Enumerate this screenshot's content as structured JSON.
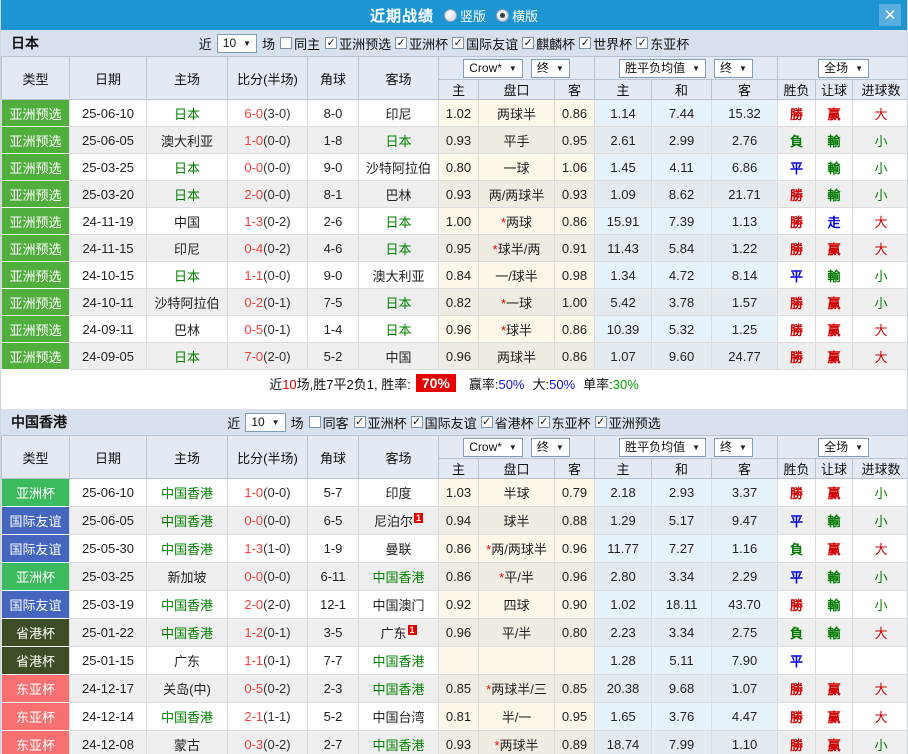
{
  "titlebar": {
    "title": "近期战绩",
    "radios": [
      {
        "label": "竖版",
        "checked": false
      },
      {
        "label": "横版",
        "checked": true
      }
    ],
    "close_icon": "✕"
  },
  "table": {
    "cols": [
      "类型",
      "日期",
      "主场",
      "比分(半场)",
      "角球",
      "客场"
    ],
    "dropdowns": {
      "crow": "Crow*",
      "end1": "终",
      "avg": "胜平负均值",
      "end2": "终",
      "full": "全场"
    },
    "sub_cols": [
      "主",
      "盘口",
      "客",
      "主",
      "和",
      "客",
      "胜负",
      "让球",
      "进球数"
    ]
  },
  "colors": {
    "titlebar": "#1d95d3",
    "types": {
      "亚洲预选": "#4fae3c",
      "亚洲杯": "#3bbb5e",
      "国际友谊": "#4466bf",
      "省港杯": "#3d4d25",
      "东亚杯": "#f97070"
    },
    "results": {
      "勝": "red",
      "赢": "red",
      "大": "red",
      "平": "blue",
      "走": "blue",
      "負": "green",
      "輸": "green",
      "小": "green"
    }
  },
  "sections": [
    {
      "team": "日本",
      "filter": {
        "near": "近",
        "count": "10",
        "games": "场",
        "same": "同主",
        "same_checked": false,
        "comps": [
          "亚洲预选",
          "亚洲杯",
          "国际友谊",
          "麒麟杯",
          "世界杯",
          "东亚杯"
        ]
      },
      "rows": [
        {
          "type": "亚洲预选",
          "date": "25-06-10",
          "home": "日本",
          "home_hot": true,
          "score": "6-0",
          "half": "(3-0)",
          "corners": "8-0",
          "away": "印尼",
          "away_hot": false,
          "odds": [
            "1.02",
            "两球半",
            "0.86"
          ],
          "avg": [
            "1.14",
            "7.44",
            "15.32"
          ],
          "res": [
            "勝",
            "赢",
            "大"
          ]
        },
        {
          "type": "亚洲预选",
          "date": "25-06-05",
          "home": "澳大利亚",
          "home_hot": false,
          "score": "1-0",
          "half": "(0-0)",
          "corners": "1-8",
          "away": "日本",
          "away_hot": true,
          "odds": [
            "0.93",
            "平手",
            "0.95"
          ],
          "avg": [
            "2.61",
            "2.99",
            "2.76"
          ],
          "res": [
            "負",
            "輸",
            "小"
          ]
        },
        {
          "type": "亚洲预选",
          "date": "25-03-25",
          "home": "日本",
          "home_hot": true,
          "score": "0-0",
          "half": "(0-0)",
          "corners": "9-0",
          "away": "沙特阿拉伯",
          "away_hot": false,
          "odds": [
            "0.80",
            "一球",
            "1.06"
          ],
          "avg": [
            "1.45",
            "4.11",
            "6.86"
          ],
          "res": [
            "平",
            "輸",
            "小"
          ]
        },
        {
          "type": "亚洲预选",
          "date": "25-03-20",
          "home": "日本",
          "home_hot": true,
          "score": "2-0",
          "half": "(0-0)",
          "corners": "8-1",
          "away": "巴林",
          "away_hot": false,
          "odds": [
            "0.93",
            "两/两球半",
            "0.93"
          ],
          "avg": [
            "1.09",
            "8.62",
            "21.71"
          ],
          "res": [
            "勝",
            "輸",
            "小"
          ]
        },
        {
          "type": "亚洲预选",
          "date": "24-11-19",
          "home": "中国",
          "home_hot": false,
          "score": "1-3",
          "half": "(0-2)",
          "corners": "2-6",
          "away": "日本",
          "away_hot": true,
          "odds": [
            "1.00",
            "*两球",
            "0.86"
          ],
          "avg": [
            "15.91",
            "7.39",
            "1.13"
          ],
          "res": [
            "勝",
            "走",
            "大"
          ]
        },
        {
          "type": "亚洲预选",
          "date": "24-11-15",
          "home": "印尼",
          "home_hot": false,
          "score": "0-4",
          "half": "(0-2)",
          "corners": "4-6",
          "away": "日本",
          "away_hot": true,
          "odds": [
            "0.95",
            "*球半/两",
            "0.91"
          ],
          "avg": [
            "11.43",
            "5.84",
            "1.22"
          ],
          "res": [
            "勝",
            "赢",
            "大"
          ]
        },
        {
          "type": "亚洲预选",
          "date": "24-10-15",
          "home": "日本",
          "home_hot": true,
          "score": "1-1",
          "half": "(0-0)",
          "corners": "9-0",
          "away": "澳大利亚",
          "away_hot": false,
          "odds": [
            "0.84",
            "一/球半",
            "0.98"
          ],
          "avg": [
            "1.34",
            "4.72",
            "8.14"
          ],
          "res": [
            "平",
            "輸",
            "小"
          ]
        },
        {
          "type": "亚洲预选",
          "date": "24-10-11",
          "home": "沙特阿拉伯",
          "home_hot": false,
          "score": "0-2",
          "half": "(0-1)",
          "corners": "7-5",
          "away": "日本",
          "away_hot": true,
          "odds": [
            "0.82",
            "*一球",
            "1.00"
          ],
          "avg": [
            "5.42",
            "3.78",
            "1.57"
          ],
          "res": [
            "勝",
            "赢",
            "小"
          ]
        },
        {
          "type": "亚洲预选",
          "date": "24-09-11",
          "home": "巴林",
          "home_hot": false,
          "score": "0-5",
          "half": "(0-1)",
          "corners": "1-4",
          "away": "日本",
          "away_hot": true,
          "odds": [
            "0.96",
            "*球半",
            "0.86"
          ],
          "avg": [
            "10.39",
            "5.32",
            "1.25"
          ],
          "res": [
            "勝",
            "赢",
            "大"
          ]
        },
        {
          "type": "亚洲预选",
          "date": "24-09-05",
          "home": "日本",
          "home_hot": true,
          "score": "7-0",
          "half": "(2-0)",
          "corners": "5-2",
          "away": "中国",
          "away_hot": false,
          "odds": [
            "0.96",
            "两球半",
            "0.86"
          ],
          "avg": [
            "1.07",
            "9.60",
            "24.77"
          ],
          "res": [
            "勝",
            "赢",
            "大"
          ]
        }
      ],
      "summary": {
        "near": "近",
        "count": "10",
        "text": "场,胜7平2负1, 胜率:",
        "rate": "70%",
        "win_label": "赢率:",
        "win": "50%",
        "big_label": "大:",
        "big": "50%",
        "single_label": "单率:",
        "single": "30%"
      }
    },
    {
      "team": "中国香港",
      "filter": {
        "near": "近",
        "count": "10",
        "games": "场",
        "same": "同客",
        "same_checked": false,
        "comps": [
          "亚洲杯",
          "国际友谊",
          "省港杯",
          "东亚杯",
          "亚洲预选"
        ]
      },
      "rows": [
        {
          "type": "亚洲杯",
          "date": "25-06-10",
          "home": "中国香港",
          "home_hot": true,
          "score": "1-0",
          "half": "(0-0)",
          "corners": "5-7",
          "away": "印度",
          "away_hot": false,
          "odds": [
            "1.03",
            "半球",
            "0.79"
          ],
          "avg": [
            "2.18",
            "2.93",
            "3.37"
          ],
          "res": [
            "勝",
            "赢",
            "小"
          ]
        },
        {
          "type": "国际友谊",
          "date": "25-06-05",
          "home": "中国香港",
          "home_hot": true,
          "score": "0-0",
          "half": "(0-0)",
          "corners": "6-5",
          "away": "尼泊尔",
          "away_hot": false,
          "away_badge": "1",
          "odds": [
            "0.94",
            "球半",
            "0.88"
          ],
          "avg": [
            "1.29",
            "5.17",
            "9.47"
          ],
          "res": [
            "平",
            "輸",
            "小"
          ]
        },
        {
          "type": "国际友谊",
          "date": "25-05-30",
          "home": "中国香港",
          "home_hot": true,
          "score": "1-3",
          "half": "(1-0)",
          "corners": "1-9",
          "away": "曼联",
          "away_hot": false,
          "odds": [
            "0.86",
            "*两/两球半",
            "0.96"
          ],
          "avg": [
            "11.77",
            "7.27",
            "1.16"
          ],
          "res": [
            "負",
            "赢",
            "大"
          ]
        },
        {
          "type": "亚洲杯",
          "date": "25-03-25",
          "home": "新加坡",
          "home_hot": false,
          "score": "0-0",
          "half": "(0-0)",
          "corners": "6-11",
          "away": "中国香港",
          "away_hot": true,
          "odds": [
            "0.86",
            "*平/半",
            "0.96"
          ],
          "avg": [
            "2.80",
            "3.34",
            "2.29"
          ],
          "res": [
            "平",
            "輸",
            "小"
          ]
        },
        {
          "type": "国际友谊",
          "date": "25-03-19",
          "home": "中国香港",
          "home_hot": true,
          "score": "2-0",
          "half": "(2-0)",
          "corners": "12-1",
          "away": "中国澳门",
          "away_hot": false,
          "odds": [
            "0.92",
            "四球",
            "0.90"
          ],
          "avg": [
            "1.02",
            "18.11",
            "43.70"
          ],
          "res": [
            "勝",
            "輸",
            "小"
          ]
        },
        {
          "type": "省港杯",
          "date": "25-01-22",
          "home": "中国香港",
          "home_hot": true,
          "score": "1-2",
          "half": "(0-1)",
          "corners": "3-5",
          "away": "广东",
          "away_hot": false,
          "away_badge": "1",
          "odds": [
            "0.96",
            "平/半",
            "0.80"
          ],
          "avg": [
            "2.23",
            "3.34",
            "2.75"
          ],
          "res": [
            "負",
            "輸",
            "大"
          ]
        },
        {
          "type": "省港杯",
          "date": "25-01-15",
          "home": "广东",
          "home_hot": false,
          "score": "1-1",
          "half": "(0-1)",
          "corners": "7-7",
          "away": "中国香港",
          "away_hot": true,
          "odds": [
            "",
            "",
            ""
          ],
          "avg": [
            "1.28",
            "5.11",
            "7.90"
          ],
          "res": [
            "平",
            "",
            ""
          ]
        },
        {
          "type": "东亚杯",
          "date": "24-12-17",
          "home": "关岛(中)",
          "home_hot": false,
          "score": "0-5",
          "half": "(0-2)",
          "corners": "2-3",
          "away": "中国香港",
          "away_hot": true,
          "odds": [
            "0.85",
            "*两球半/三",
            "0.85"
          ],
          "avg": [
            "20.38",
            "9.68",
            "1.07"
          ],
          "res": [
            "勝",
            "赢",
            "大"
          ]
        },
        {
          "type": "东亚杯",
          "date": "24-12-14",
          "home": "中国香港",
          "home_hot": true,
          "score": "2-1",
          "half": "(1-1)",
          "corners": "5-2",
          "away": "中国台湾",
          "away_hot": false,
          "odds": [
            "0.81",
            "半/一",
            "0.95"
          ],
          "avg": [
            "1.65",
            "3.76",
            "4.47"
          ],
          "res": [
            "勝",
            "赢",
            "大"
          ]
        },
        {
          "type": "东亚杯",
          "date": "24-12-08",
          "home": "蒙古",
          "home_hot": false,
          "score": "0-3",
          "half": "(0-2)",
          "corners": "2-7",
          "away": "中国香港",
          "away_hot": true,
          "odds": [
            "0.93",
            "*两球半",
            "0.89"
          ],
          "avg": [
            "18.74",
            "7.99",
            "1.10"
          ],
          "res": [
            "勝",
            "赢",
            "小"
          ]
        }
      ],
      "summary": null
    }
  ]
}
